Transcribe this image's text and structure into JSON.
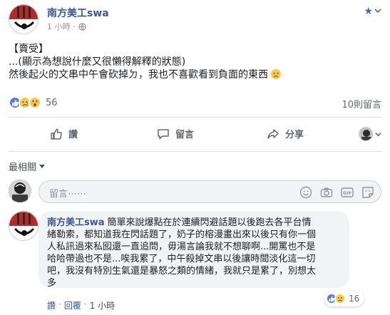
{
  "post": {
    "author": "南方美工swa",
    "time": "1 小時",
    "body_lines": [
      "【賣受】",
      "...(顯示為想說什麼又很懶得解釋的狀態)",
      "然後起火的文串中午會砍掉ㄉ，我也不喜歡看到負面的東西"
    ],
    "reaction_count": "56",
    "comment_count": "10則留言",
    "icons": [
      "follow-star-icon",
      "chevron-down-icon",
      "globe-icon",
      "sad-emoji"
    ]
  },
  "actions": {
    "like": "讚",
    "comment": "留言",
    "share": "分享"
  },
  "comments_section": {
    "sort_label": "最相關",
    "composer_placeholder": "留言⋯⋯",
    "tools": [
      "emoji-icon",
      "camera-icon",
      "gif-icon",
      "sticker-icon"
    ]
  },
  "comment": {
    "author": "南方美工swa",
    "lines": [
      "簡單來說爆點在於連續閃避話題以後跑去各平台情",
      "緒勒索，都知道我在閃話題了，奶子的榕漫畫出來以後只有你一個",
      "人私訊過來私囮還一直追問，毋湯言論我就不想聊啊...開罵也不是",
      "哈哈帶過也不是...唉我累了，中午殺掉文串以後讓時間淡化這一切",
      "吧，我沒有特別生氣還是暴怒之類的情緒，我就只是累了，別想太",
      "多"
    ],
    "reaction_count": "16",
    "footer": {
      "like": "讚",
      "reply": "回覆",
      "time": "1 小時"
    }
  },
  "colors": {
    "link_blue": "#385898",
    "like_blue": "#4a7bf7",
    "emoji_yellow": "#f7c948",
    "muted_gray": "#90949c"
  }
}
